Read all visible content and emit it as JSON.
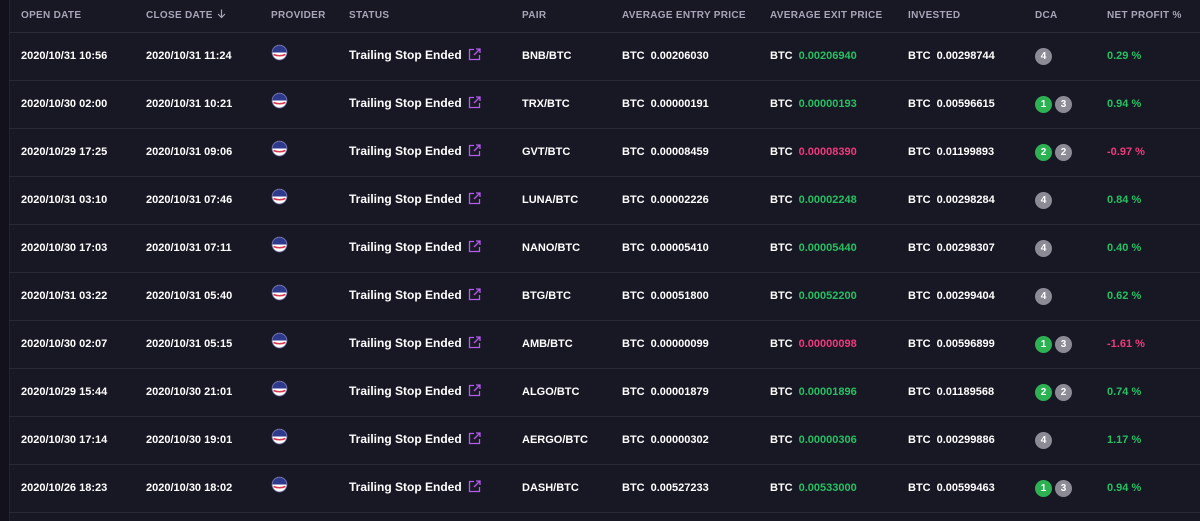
{
  "headers": {
    "open_date": "OPEN DATE",
    "close_date": "CLOSE DATE",
    "provider": "PROVIDER",
    "status": "STATUS",
    "pair": "PAIR",
    "avg_entry": "AVERAGE ENTRY PRICE",
    "avg_exit": "AVERAGE EXIT PRICE",
    "invested": "INVESTED",
    "dca": "DCA",
    "net_profit": "NET PROFIT %"
  },
  "icons": {
    "sort": "arrow-down-icon",
    "provider": "provider-logo-icon",
    "external_link": "external-link-icon"
  },
  "colors": {
    "positive": "#26c061",
    "negative": "#f0397b",
    "dca_green": "#2eb153",
    "dca_grey": "#8b8a95",
    "link": "#b45cf0"
  },
  "rows": [
    {
      "open": "2020/10/31 10:56",
      "close": "2020/10/31 11:24",
      "status": "Trailing Stop Ended",
      "pair": "BNB/BTC",
      "entry_ccy": "BTC",
      "entry": "0.00206030",
      "exit_ccy": "BTC",
      "exit": "0.00206940",
      "exit_dir": "up",
      "inv_ccy": "BTC",
      "invested": "0.00298744",
      "dca_green": "",
      "dca_grey": "4",
      "profit": "0.29 %",
      "profit_dir": "up"
    },
    {
      "open": "2020/10/30 02:00",
      "close": "2020/10/31 10:21",
      "status": "Trailing Stop Ended",
      "pair": "TRX/BTC",
      "entry_ccy": "BTC",
      "entry": "0.00000191",
      "exit_ccy": "BTC",
      "exit": "0.00000193",
      "exit_dir": "up",
      "inv_ccy": "BTC",
      "invested": "0.00596615",
      "dca_green": "1",
      "dca_grey": "3",
      "profit": "0.94 %",
      "profit_dir": "up"
    },
    {
      "open": "2020/10/29 17:25",
      "close": "2020/10/31 09:06",
      "status": "Trailing Stop Ended",
      "pair": "GVT/BTC",
      "entry_ccy": "BTC",
      "entry": "0.00008459",
      "exit_ccy": "BTC",
      "exit": "0.00008390",
      "exit_dir": "down",
      "inv_ccy": "BTC",
      "invested": "0.01199893",
      "dca_green": "2",
      "dca_grey": "2",
      "profit": "-0.97 %",
      "profit_dir": "down"
    },
    {
      "open": "2020/10/31 03:10",
      "close": "2020/10/31 07:46",
      "status": "Trailing Stop Ended",
      "pair": "LUNA/BTC",
      "entry_ccy": "BTC",
      "entry": "0.00002226",
      "exit_ccy": "BTC",
      "exit": "0.00002248",
      "exit_dir": "up",
      "inv_ccy": "BTC",
      "invested": "0.00298284",
      "dca_green": "",
      "dca_grey": "4",
      "profit": "0.84 %",
      "profit_dir": "up"
    },
    {
      "open": "2020/10/30 17:03",
      "close": "2020/10/31 07:11",
      "status": "Trailing Stop Ended",
      "pair": "NANO/BTC",
      "entry_ccy": "BTC",
      "entry": "0.00005410",
      "exit_ccy": "BTC",
      "exit": "0.00005440",
      "exit_dir": "up",
      "inv_ccy": "BTC",
      "invested": "0.00298307",
      "dca_green": "",
      "dca_grey": "4",
      "profit": "0.40 %",
      "profit_dir": "up"
    },
    {
      "open": "2020/10/31 03:22",
      "close": "2020/10/31 05:40",
      "status": "Trailing Stop Ended",
      "pair": "BTG/BTC",
      "entry_ccy": "BTC",
      "entry": "0.00051800",
      "exit_ccy": "BTC",
      "exit": "0.00052200",
      "exit_dir": "up",
      "inv_ccy": "BTC",
      "invested": "0.00299404",
      "dca_green": "",
      "dca_grey": "4",
      "profit": "0.62 %",
      "profit_dir": "up"
    },
    {
      "open": "2020/10/30 02:07",
      "close": "2020/10/31 05:15",
      "status": "Trailing Stop Ended",
      "pair": "AMB/BTC",
      "entry_ccy": "BTC",
      "entry": "0.00000099",
      "exit_ccy": "BTC",
      "exit": "0.00000098",
      "exit_dir": "down",
      "inv_ccy": "BTC",
      "invested": "0.00596899",
      "dca_green": "1",
      "dca_grey": "3",
      "profit": "-1.61 %",
      "profit_dir": "down"
    },
    {
      "open": "2020/10/29 15:44",
      "close": "2020/10/30 21:01",
      "status": "Trailing Stop Ended",
      "pair": "ALGO/BTC",
      "entry_ccy": "BTC",
      "entry": "0.00001879",
      "exit_ccy": "BTC",
      "exit": "0.00001896",
      "exit_dir": "up",
      "inv_ccy": "BTC",
      "invested": "0.01189568",
      "dca_green": "2",
      "dca_grey": "2",
      "profit": "0.74 %",
      "profit_dir": "up"
    },
    {
      "open": "2020/10/30 17:14",
      "close": "2020/10/30 19:01",
      "status": "Trailing Stop Ended",
      "pair": "AERGO/BTC",
      "entry_ccy": "BTC",
      "entry": "0.00000302",
      "exit_ccy": "BTC",
      "exit": "0.00000306",
      "exit_dir": "up",
      "inv_ccy": "BTC",
      "invested": "0.00299886",
      "dca_green": "",
      "dca_grey": "4",
      "profit": "1.17 %",
      "profit_dir": "up"
    },
    {
      "open": "2020/10/26 18:23",
      "close": "2020/10/30 18:02",
      "status": "Trailing Stop Ended",
      "pair": "DASH/BTC",
      "entry_ccy": "BTC",
      "entry": "0.00527233",
      "exit_ccy": "BTC",
      "exit": "0.00533000",
      "exit_dir": "up",
      "inv_ccy": "BTC",
      "invested": "0.00599463",
      "dca_green": "1",
      "dca_grey": "3",
      "profit": "0.94 %",
      "profit_dir": "up"
    }
  ]
}
